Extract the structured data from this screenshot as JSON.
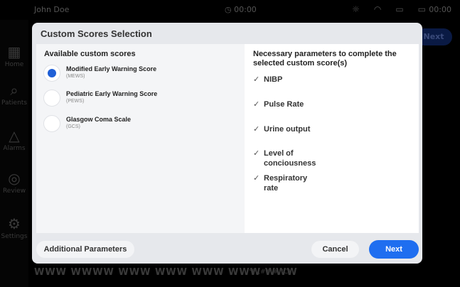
{
  "status_bar": {
    "left_text": "John Doe",
    "clock_text": "00:00",
    "right_time": "00:00"
  },
  "nav": {
    "items": [
      {
        "label": "Home",
        "icon": "table-icon",
        "glyph": "▦"
      },
      {
        "label": "Patients",
        "icon": "patient-search-icon",
        "glyph": "⌕"
      },
      {
        "label": "Alarms",
        "icon": "warning-triangle-icon",
        "glyph": "△"
      },
      {
        "label": "Review",
        "icon": "review-icon",
        "glyph": "◎"
      },
      {
        "label": "Settings",
        "icon": "gear-icon",
        "glyph": "⚙"
      }
    ]
  },
  "background": {
    "next_label": "Next",
    "waves_text": "WWW WWWW WWW WWW WWW WWW WWW",
    "temp_text": "°F (##.# °C)"
  },
  "dialog": {
    "title": "Custom Scores Selection",
    "available_title": "Available custom scores",
    "scores": [
      {
        "name": "Modified Early Warning Score",
        "abbr": "(MEWS)",
        "selected": true
      },
      {
        "name": "Pediatric Early Warning Score",
        "abbr": "(PEWS)",
        "selected": false
      },
      {
        "name": "Glasgow Coma Scale",
        "abbr": "(GCS)",
        "selected": false
      }
    ],
    "params_title": "Necessary parameters to complete the selected custom score(s)",
    "check_glyph": "✓",
    "parameters": [
      "NIBP",
      "Pulse Rate",
      "Urine output",
      "Level of conciousness",
      "Respiratory rate"
    ],
    "buttons": {
      "additional": "Additional Parameters",
      "cancel": "Cancel",
      "next": "Next"
    }
  },
  "colors": {
    "accent": "#1f6ef0",
    "radio_selected": "#1f5fd6",
    "dialog_bg": "#e6e8ec"
  }
}
